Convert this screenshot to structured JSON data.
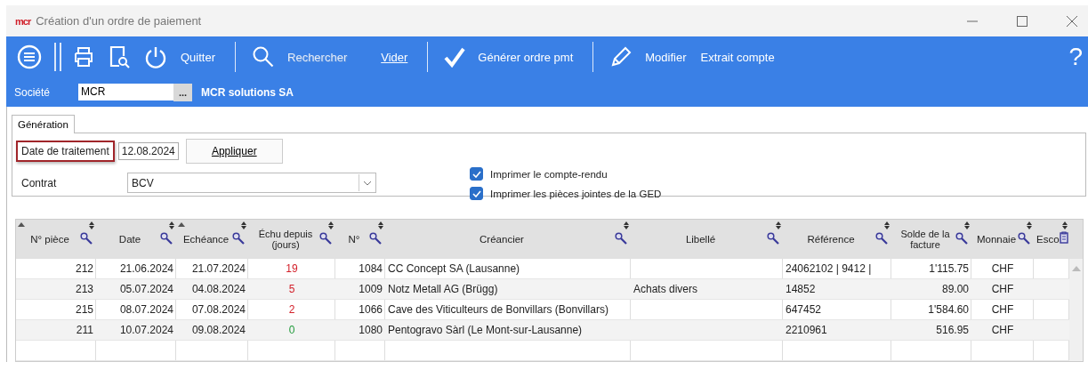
{
  "window": {
    "logo": "mcr",
    "title": "Création d'un ordre de paiement"
  },
  "toolbar": {
    "buttons": [
      {
        "label": "Quitter",
        "disabled": false
      },
      {
        "label": "Rechercher",
        "disabled": true
      },
      {
        "label": "Vider",
        "disabled": false
      },
      {
        "label": "Générer ordre pmt",
        "disabled": false
      },
      {
        "label": "Modifier",
        "disabled": false
      },
      {
        "label": "Extrait compte",
        "disabled": false
      }
    ],
    "help": "?"
  },
  "company": {
    "label": "Société",
    "value": "MCR",
    "browse": "...",
    "name": "MCR solutions SA"
  },
  "tabs": [
    {
      "label": "Génération",
      "selected": true
    }
  ],
  "form": {
    "date_label": "Date de traitement",
    "date_highlighted": true,
    "date_value": "12.08.2024",
    "apply": "Appliquer",
    "contract_label": "Contrat",
    "contract_value": "BCV",
    "options": [
      {
        "label": "Imprimer le compte-rendu",
        "checked": true
      },
      {
        "label": "Imprimer les pièces jointes de la GED",
        "checked": true
      }
    ]
  },
  "table": {
    "columns": [
      {
        "label": "N° pièce",
        "sorted": true
      },
      {
        "label": "Date",
        "sorted": false
      },
      {
        "label": "Echéance",
        "sorted": true
      },
      {
        "label": "Échu depuis (jours)",
        "sorted": false
      },
      {
        "label": "N°",
        "sorted": false
      },
      {
        "label": "Créancier",
        "sorted": false
      },
      {
        "label": "Libellé",
        "sorted": false
      },
      {
        "label": "Référence",
        "sorted": false
      },
      {
        "label": "Solde de la facture",
        "sorted": false
      },
      {
        "label": "Monnaie",
        "sorted": false
      },
      {
        "label": "Esco",
        "sorted": false
      }
    ],
    "rows": [
      {
        "cells": [
          "212",
          "21.06.2024",
          "21.07.2024",
          "19",
          "1084",
          "CC Concept SA (Lausanne)",
          "",
          "24062102 | 9412 |",
          "1'115.75",
          "CHF",
          ""
        ],
        "overdue": true
      },
      {
        "cells": [
          "213",
          "05.07.2024",
          "04.08.2024",
          "5",
          "1009",
          "Notz Metall AG (Brügg)",
          "Achats divers",
          "14852",
          "89.00",
          "CHF",
          ""
        ],
        "overdue": true
      },
      {
        "cells": [
          "215",
          "08.07.2024",
          "07.08.2024",
          "2",
          "1066",
          "Cave des Viticulteurs de Bonvillars (Bonvillars)",
          "",
          "647452",
          "1'584.60",
          "CHF",
          ""
        ],
        "overdue": true
      },
      {
        "cells": [
          "211",
          "10.07.2024",
          "09.08.2024",
          "0",
          "1080",
          "Pentogravo Sàrl (Le Mont-sur-Lausanne)",
          "",
          "2210961",
          "516.95",
          "CHF",
          ""
        ],
        "overdue": false
      }
    ]
  }
}
